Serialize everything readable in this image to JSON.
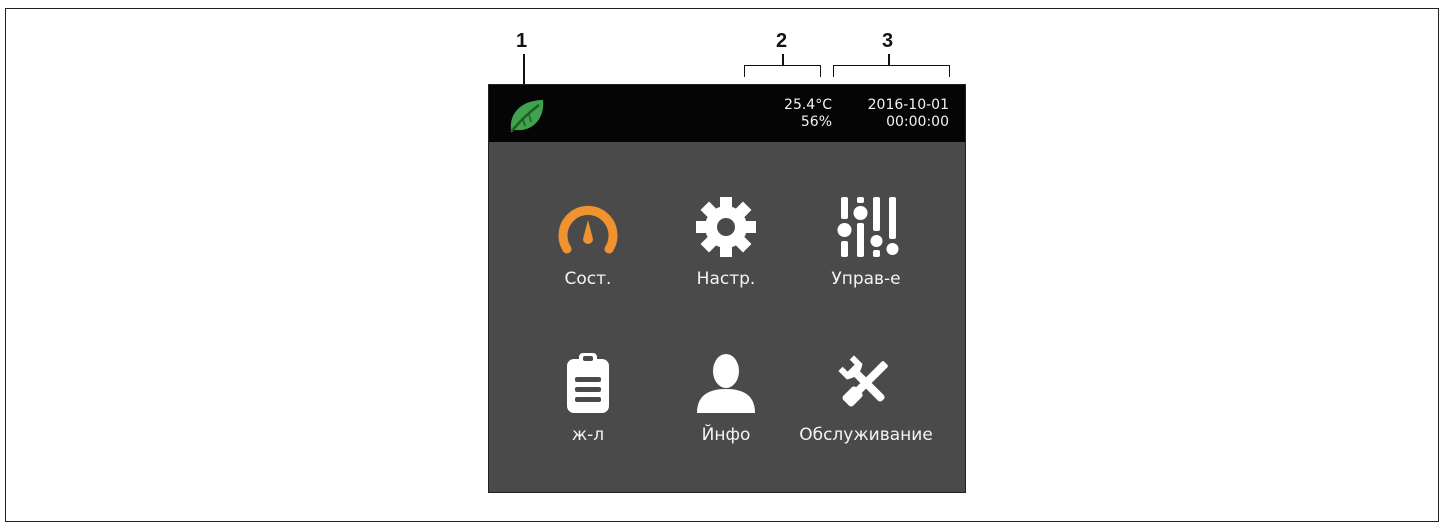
{
  "callouts": [
    "1",
    "2",
    "3"
  ],
  "status": {
    "temperature": "25.4°C",
    "humidity": "56%",
    "date": "2016-10-01",
    "time": "00:00:00",
    "logo_icon": "leaf-icon"
  },
  "menu": [
    {
      "label": "Сост.",
      "icon": "gauge-icon",
      "color": "#f0922f"
    },
    {
      "label": "Настр.",
      "icon": "gear-icon",
      "color": "#ffffff"
    },
    {
      "label": "Управ-е",
      "icon": "sliders-icon",
      "color": "#ffffff"
    },
    {
      "label": "ж-л",
      "icon": "clipboard-icon",
      "color": "#ffffff"
    },
    {
      "label": "Йнфо",
      "icon": "user-icon",
      "color": "#ffffff"
    },
    {
      "label": "Обслуживание",
      "icon": "tools-icon",
      "color": "#ffffff"
    }
  ],
  "colors": {
    "screen_background": "#4a4a4a",
    "status_bar": "#050505",
    "leaf": "#3fa34d",
    "accent": "#f0922f"
  }
}
